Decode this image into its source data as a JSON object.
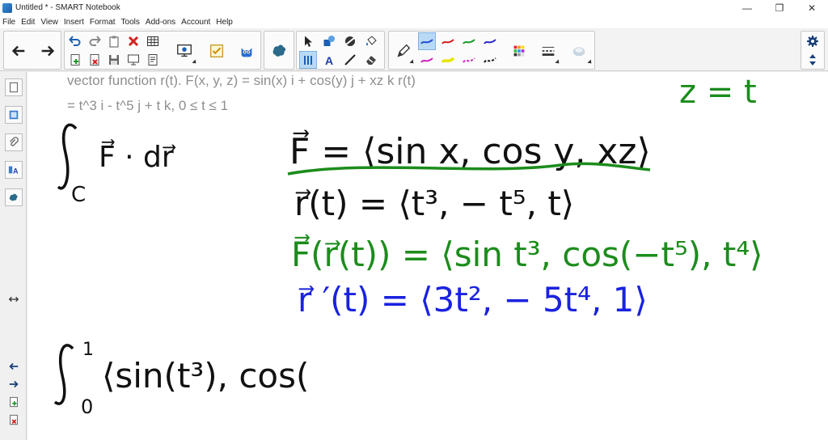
{
  "window": {
    "title": "Untitled * - SMART Notebook",
    "controls": [
      "—",
      "❐",
      "✕"
    ]
  },
  "menu": {
    "items": [
      "File",
      "Edit",
      "View",
      "Insert",
      "Format",
      "Tools",
      "Add-ons",
      "Account",
      "Help"
    ]
  },
  "toolbar": {
    "pen_colors": [
      "#1e4fd8",
      "#d42020",
      "#1a9a2a",
      "#2a2ad0",
      "#d020c0",
      "#e6e600",
      "#d020c0",
      "#111111"
    ],
    "palette_label": "color-palette"
  },
  "canvas": {
    "problem_line1": "vector function r(t). F(x, y, z) = sin(x) i + cos(y) j + xz k r(t)",
    "problem_line2": "= t^3 i - t^5 j + t k, 0 ≤ t ≤ 1",
    "ink": {
      "z_eq_t": "z = t",
      "integral_lower": "C",
      "integral_body": "F⃗ · dr⃗",
      "F_def": "F⃗ = ⟨sin x, cos y, xz⟩",
      "r_def": "r⃗(t) = ⟨t³, − t⁵, t⟩",
      "F_of_r": "F⃗(r⃗(t)) = ⟨sin t³, cos(−t⁵), t⁴⟩",
      "r_prime": "r⃗ ′(t) = ⟨3t², − 5t⁴, 1⟩",
      "int2_upper": "1",
      "int2_lower": "0",
      "int2_body": "⟨sin(t³), cos("
    },
    "colors": {
      "black_ink": "#111111",
      "green_ink": "#1c8c1c",
      "blue_ink": "#1a22e0",
      "problem_text": "#8f8f8f"
    }
  }
}
